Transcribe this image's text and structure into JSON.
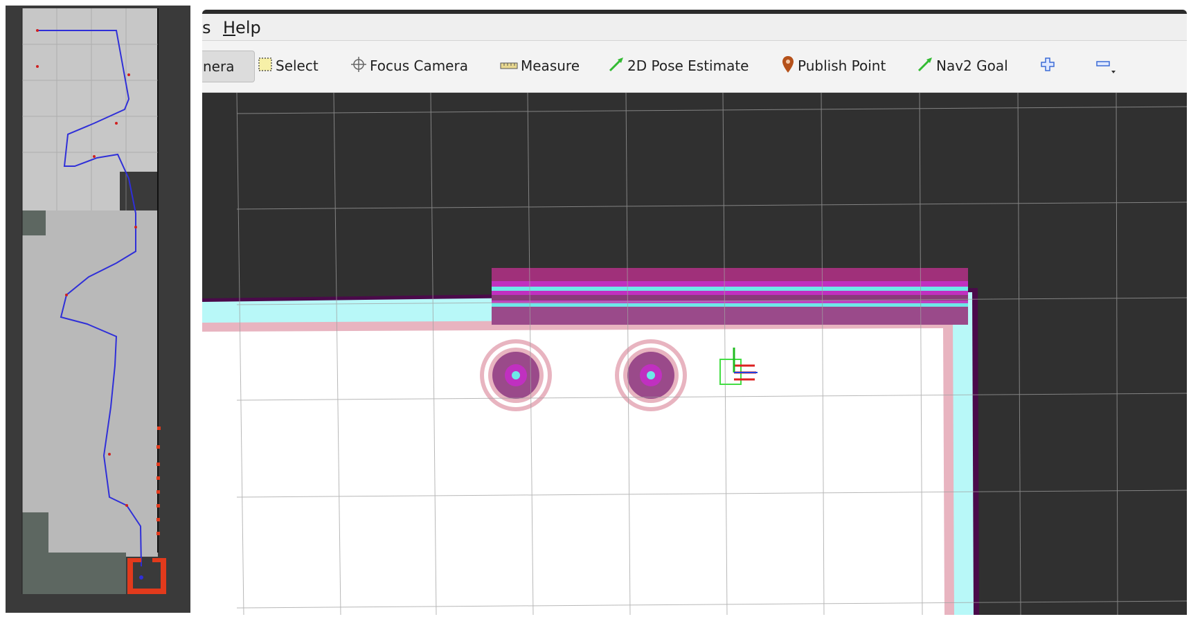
{
  "left_map": {
    "colors": {
      "background": "#3a3a3a",
      "free_space": "#b9b9b9",
      "grid": "#9e9e9e",
      "path": "#2f2fd8",
      "path_waypoints": "#d02020",
      "start_box": "#e23a1c",
      "unknown_block": "#5d6761"
    }
  },
  "menu": {
    "items": [
      {
        "text": "s",
        "mnemonic": ""
      },
      {
        "text": "elp",
        "mnemonic": "H"
      }
    ]
  },
  "toolbar": {
    "tools": [
      {
        "name": "interact-camera-tool",
        "label": "nera",
        "icon": "none",
        "active": true
      },
      {
        "name": "select-tool",
        "label": "Select",
        "icon": "select-box-icon",
        "active": false
      },
      {
        "name": "focus-camera-tool",
        "label": "Focus Camera",
        "icon": "crosshair-icon",
        "active": false
      },
      {
        "name": "measure-tool",
        "label": "Measure",
        "icon": "ruler-icon",
        "active": false
      },
      {
        "name": "pose-estimate-tool",
        "label": "2D Pose Estimate",
        "icon": "green-arrow-icon",
        "active": false
      },
      {
        "name": "publish-point-tool",
        "label": "Publish Point",
        "icon": "map-pin-icon",
        "active": false
      },
      {
        "name": "nav2-goal-tool",
        "label": "Nav2 Goal",
        "icon": "green-arrow-icon",
        "active": false
      }
    ],
    "add_tool": {
      "icon": "plus-icon"
    },
    "remove_tool": {
      "icon": "minus-icon"
    }
  },
  "viewport": {
    "colors": {
      "background": "#303030",
      "grid_lines": "#a0a0a0",
      "free_space": "#ffffff",
      "inflation_cyan": "#b8f8f8",
      "inflation_pink": "#e8b4c0",
      "lethal": "#4a0a4a",
      "costmap_high": "#c030c0",
      "costmap_mid": "#9a4a8a",
      "robot_footprint": "#44dd44",
      "axis_x": "#dd2020",
      "axis_y": "#20bb20",
      "axis_z": "#2040dd"
    }
  }
}
